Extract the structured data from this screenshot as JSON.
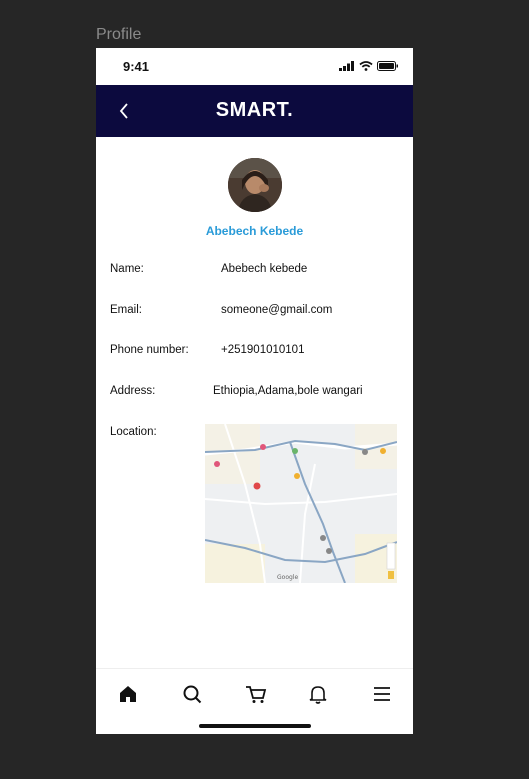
{
  "frame": {
    "label": "Profile"
  },
  "status_bar": {
    "time": "9:41"
  },
  "header": {
    "brand": "SMART."
  },
  "profile": {
    "name": "Abebech Kebede"
  },
  "fields": [
    {
      "label": "Name:",
      "value": "Abebech kebede"
    },
    {
      "label": "Email:",
      "value": "someone@gmail.com"
    },
    {
      "label": "Phone number:",
      "value": "+251901010101"
    },
    {
      "label": "Address:",
      "value": "Ethiopia,Adama,bole wangari"
    },
    {
      "label": "Location:",
      "value": ""
    }
  ],
  "map": {
    "provider_mark": "Google"
  },
  "tabbar": {
    "items": [
      {
        "icon": "home-icon",
        "active": true
      },
      {
        "icon": "search-icon",
        "active": false
      },
      {
        "icon": "cart-icon",
        "active": false
      },
      {
        "icon": "bell-icon",
        "active": false
      },
      {
        "icon": "menu-icon",
        "active": false
      }
    ]
  },
  "colors": {
    "navbar": "#0c0a3e",
    "accent": "#2a9bd8",
    "background": "#262626"
  }
}
